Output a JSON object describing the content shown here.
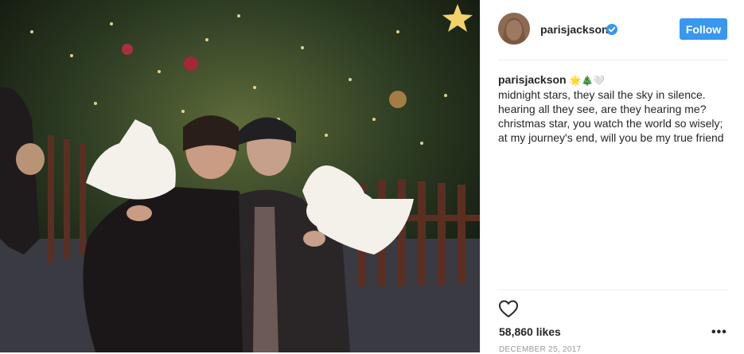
{
  "post": {
    "username": "parisjackson",
    "follow_label": "Follow",
    "caption_user": "parisjackson",
    "caption_emoji": "🌟🎄🤍",
    "caption_lines": [
      "midnight stars, they sail the sky in silence.",
      "hearing all they see, are they hearing me?",
      "christmas star, you watch the world so wisely;",
      "at my journey's end, will you be my true friend"
    ],
    "likes": "58,860 likes",
    "more_label": "•••",
    "date": "DECEMBER 25, 2017"
  },
  "icons": {
    "verified": "verified-badge-icon",
    "like": "heart-icon",
    "more": "more-options-icon"
  },
  "colors": {
    "follow_button": "#3897f0",
    "verified_badge": "#3897f0",
    "text": "#262626",
    "muted": "#999999",
    "divider": "#efefef"
  }
}
